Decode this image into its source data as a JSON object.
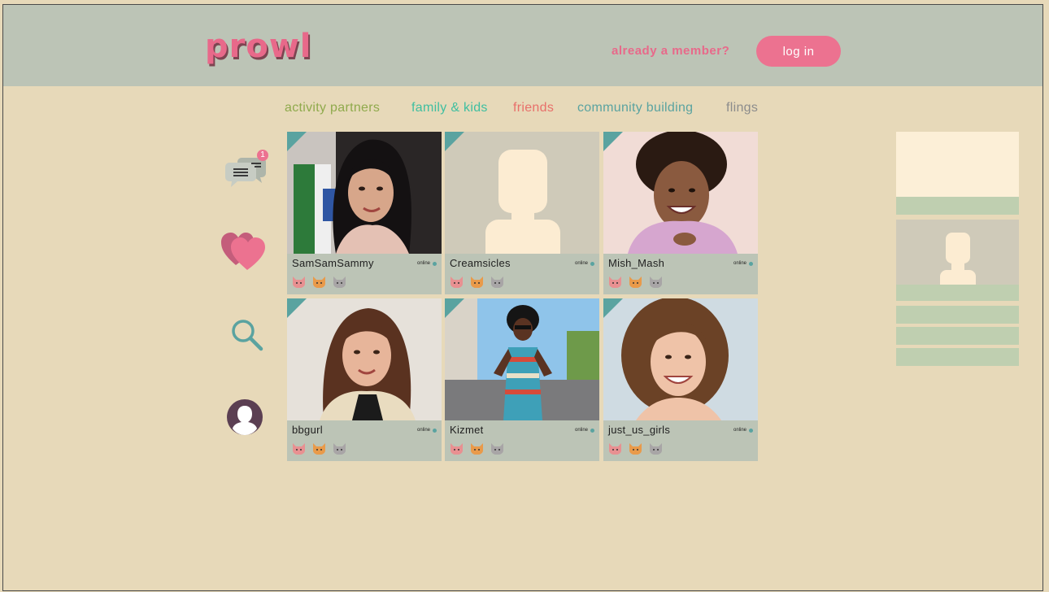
{
  "header": {
    "logo": "prowl",
    "member_link": "already a member?",
    "login_label": "log in"
  },
  "nav": {
    "items": [
      {
        "label": "activity partners",
        "color": "#8faa4c"
      },
      {
        "label": "family & kids",
        "color": "#3fbfa0"
      },
      {
        "label": "friends",
        "color": "#e86f6a"
      },
      {
        "label": "community building",
        "color": "#5aa3a0"
      },
      {
        "label": "flings",
        "color": "#8c8c8c"
      }
    ]
  },
  "sidebar": {
    "messages_badge": "1",
    "icons": [
      "chat-icon",
      "hearts-icon",
      "search-icon",
      "profile-icon"
    ]
  },
  "profiles": [
    {
      "username": "SamSamSammy",
      "status": "online",
      "photo": "photo"
    },
    {
      "username": "Creamsicles",
      "status": "online",
      "photo": "placeholder"
    },
    {
      "username": "Mish_Mash",
      "status": "online",
      "photo": "photo"
    },
    {
      "username": "bbgurl",
      "status": "online",
      "photo": "photo"
    },
    {
      "username": "Kizmet",
      "status": "online",
      "photo": "photo"
    },
    {
      "username": "just_us_girls",
      "status": "online",
      "photo": "photo"
    }
  ],
  "colors": {
    "header_bg": "#bcc4b6",
    "page_bg": "#e7d9b9",
    "accent_pink": "#ec7290",
    "teal": "#5aa3a0",
    "card_bg": "#bcc4b6",
    "placeholder_bg": "#cfcab9",
    "placeholder_fg": "#fcecd2",
    "panel_green": "#bfcfb0"
  }
}
